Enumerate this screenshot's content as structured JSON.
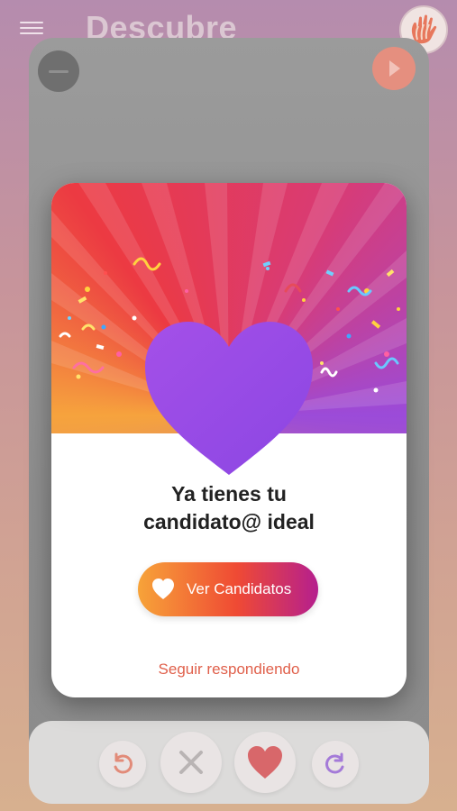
{
  "header": {
    "title": "Descubre",
    "menu_icon": "hamburger-icon",
    "profile_icon": "hand-avatar-icon"
  },
  "modal": {
    "message_line1": "Ya tienes tu",
    "message_line2": "candidato@ ideal",
    "primary_button": "Ver Candidatos",
    "secondary_link": "Seguir respondiendo",
    "heart_icon": "heart-icon"
  },
  "actions": [
    {
      "name": "undo",
      "icon": "undo-icon"
    },
    {
      "name": "dislike",
      "icon": "close-icon"
    },
    {
      "name": "like",
      "icon": "heart-icon"
    },
    {
      "name": "redo",
      "icon": "redo-icon"
    }
  ],
  "colors": {
    "accent": "#e0604b",
    "heart": "#9a4ce0",
    "button_start": "#f7a339",
    "button_end": "#b51f8e"
  }
}
